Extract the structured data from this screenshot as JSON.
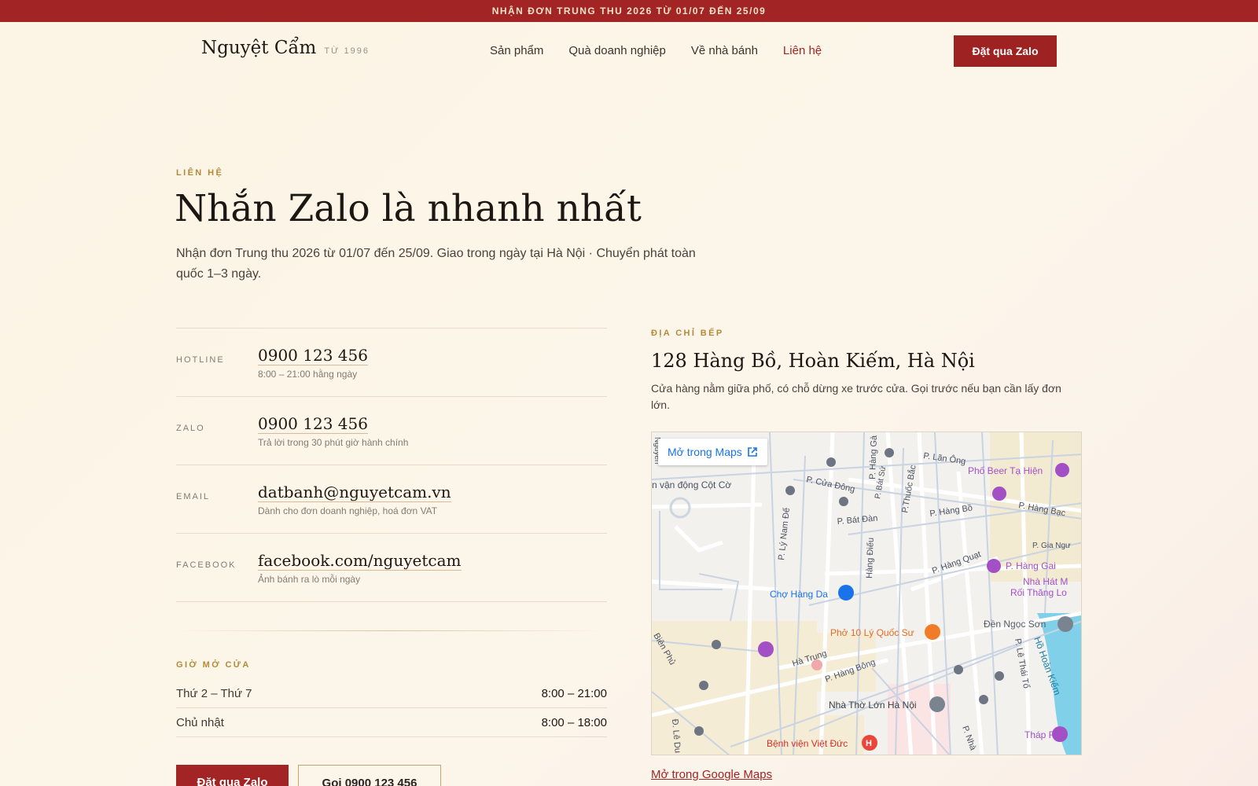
{
  "banner": {
    "text": "NHẬN ĐƠN TRUNG THU 2026 TỪ 01/07 ĐẾN 25/09"
  },
  "header": {
    "brand": "Nguyệt Cẩm",
    "since": "TỪ 1996",
    "nav": [
      "Sản phẩm",
      "Quà doanh nghiệp",
      "Về nhà bánh",
      "Liên hệ"
    ],
    "active_nav": "Liên hệ",
    "cta": "Đặt qua Zalo"
  },
  "hero": {
    "eyebrow": "LIÊN HỆ",
    "title": "Nhắn Zalo là nhanh nhất",
    "subtitle": "Nhận đơn Trung thu 2026 từ 01/07 đến 25/09. Giao trong ngày tại Hà Nội · Chuyển phát toàn quốc 1–3 ngày."
  },
  "contacts": [
    {
      "label": "HOTLINE",
      "value": "0900 123 456",
      "note": "8:00 – 21:00 hằng ngày"
    },
    {
      "label": "ZALO",
      "value": "0900 123 456",
      "note": "Trả lời trong 30 phút giờ hành chính"
    },
    {
      "label": "EMAIL",
      "value": "datbanh@nguyetcam.vn",
      "note": "Dành cho đơn doanh nghiệp, hoá đơn VAT"
    },
    {
      "label": "FACEBOOK",
      "value": "facebook.com/nguyetcam",
      "note": "Ảnh bánh ra lò mỗi ngày"
    }
  ],
  "hours": {
    "eyebrow": "GIỜ MỞ CỬA",
    "rows": [
      {
        "day": "Thứ 2 – Thứ 7",
        "time": "8:00 – 21:00"
      },
      {
        "day": "Chủ nhật",
        "time": "8:00 – 18:00"
      }
    ]
  },
  "buttons": {
    "primary": "Đặt qua Zalo",
    "secondary": "Gọi 0900 123 456"
  },
  "address": {
    "eyebrow": "ĐỊA CHỈ BẾP",
    "title": "128 Hàng Bồ, Hoàn Kiếm, Hà Nội",
    "note": "Cửa hàng nằm giữa phố, có chỗ dừng xe trước cửa. Gọi trước nếu bạn cần lấy đơn lớn."
  },
  "map": {
    "open_label": "Mở trong Maps",
    "gmaps_link": "Mở trong Google Maps",
    "streets": [
      "P. Lãn Ông",
      "P. Cửa Đông",
      "P. Bát Sứ",
      "P.Thuốc Bắc",
      "P. Hàng Gà",
      "P. Hàng Bồ",
      "P. Hàng Bạc",
      "P. Bát Đàn",
      "P. Lý Nam Đế",
      "Hàng Điếu",
      "P. Gia Ngư",
      "P. Hàng Quạt",
      "P. Hàng Gai",
      "P. Lê Thái Tổ",
      "P. Hàng Bông",
      "Hà Trung",
      "P. Nhà",
      "Biên Phủ",
      "Đ. Lê Du",
      "Nguyễn",
      "n vận động Cột Cờ"
    ],
    "places": [
      "Phố Beer Tạ Hiện",
      "Nhà Hát M",
      "Rối Thăng Lo",
      "Chợ Hàng Da",
      "Đền Ngọc Sơn",
      "Phở 10 Lý Quốc Sư",
      "Hồ Hoàn Kiếm",
      "Nhà Thờ Lớn Hà Nội",
      "Tháp Rùa",
      "Bệnh viện Việt Đức"
    ]
  }
}
